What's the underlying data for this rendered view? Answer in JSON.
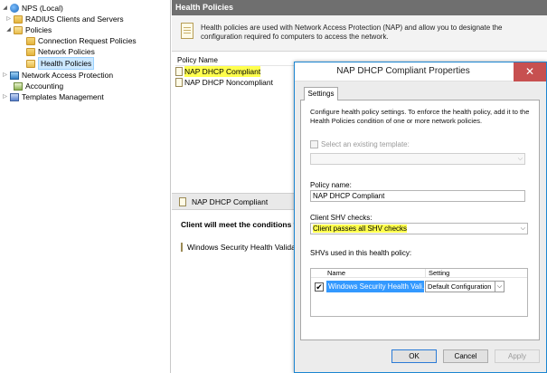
{
  "tree": {
    "items": [
      {
        "label": "NPS (Local)",
        "expander": "◢"
      },
      {
        "label": "RADIUS Clients and Servers",
        "expander": "▷"
      },
      {
        "label": "Policies",
        "expander": "◢"
      },
      {
        "label": "Connection Request Policies",
        "expander": ""
      },
      {
        "label": "Network Policies",
        "expander": ""
      },
      {
        "label": "Health Policies",
        "expander": ""
      },
      {
        "label": "Network Access Protection",
        "expander": "▷"
      },
      {
        "label": "Accounting",
        "expander": ""
      },
      {
        "label": "Templates Management",
        "expander": "▷"
      }
    ]
  },
  "pane": {
    "header": "Health Policies",
    "info": "Health policies are used with Network Access Protection (NAP) and allow you to designate the configuration required fo computers to access the network.",
    "column_header": "Policy Name",
    "policies": [
      "NAP DHCP Compliant",
      "NAP DHCP Noncompliant"
    ],
    "detail_title": "NAP DHCP Compliant",
    "condition_text": "Client will meet the conditions fo",
    "shv_item": "Windows Security Health Validator"
  },
  "dialog": {
    "title": "NAP DHCP Compliant Properties",
    "close_glyph": "✕",
    "tab_label": "Settings",
    "description": "Configure health policy settings. To enforce the health policy, add it to the Health Policies condition of one or more network policies.",
    "template_checkbox_label": "Select an existing template:",
    "template_value": "",
    "policy_name_label": "Policy name:",
    "policy_name_value": "NAP DHCP Compliant",
    "client_checks_label": "Client SHV checks:",
    "client_checks_value": "Client passes all SHV checks",
    "shv_list_label": "SHVs used in this health policy:",
    "shv_columns": [
      "Name",
      "Setting"
    ],
    "shv_rows": [
      {
        "checked": "✔",
        "name": "Windows Security Health Vali...",
        "setting": "Default Configuration"
      }
    ],
    "buttons": {
      "ok": "OK",
      "cancel": "Cancel",
      "apply": "Apply"
    },
    "dropdown_glyph": "⌵"
  },
  "colors": {
    "highlight": "#ffff4d",
    "selection": "#3399ff",
    "header_bar": "#6f6f6f",
    "close_button": "#c75050",
    "dialog_border": "#1c86d1"
  }
}
